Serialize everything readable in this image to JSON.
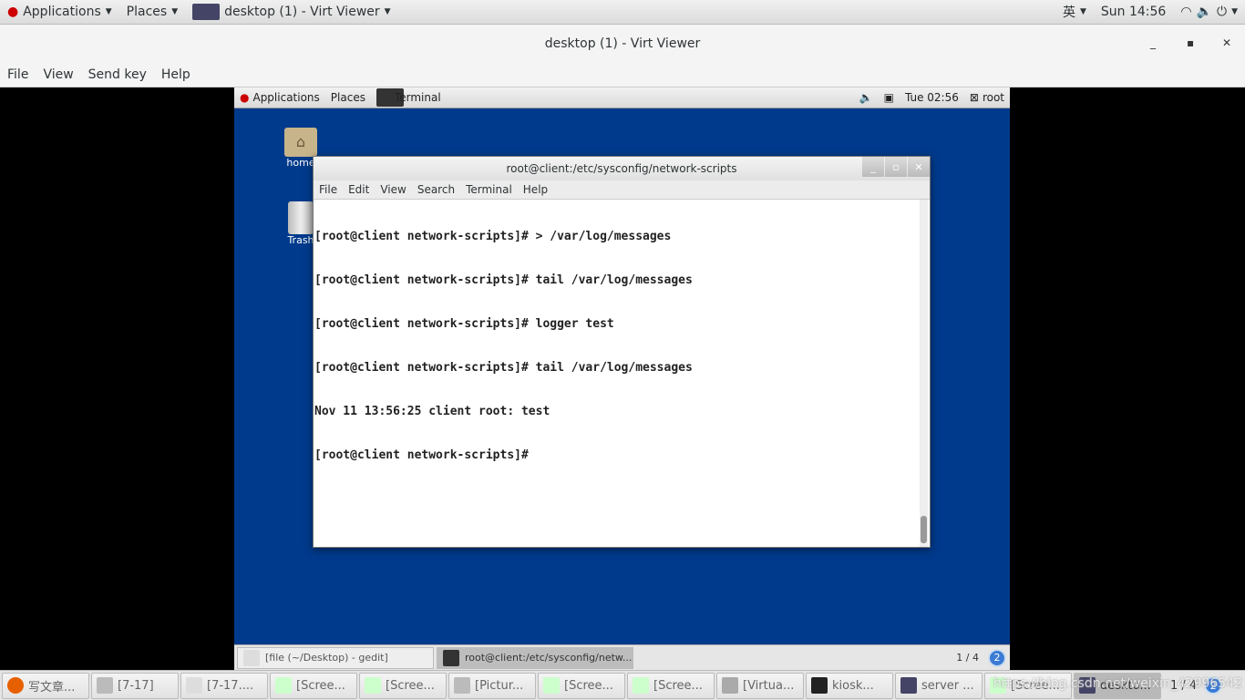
{
  "host_top": {
    "applications": "Applications",
    "places": "Places",
    "active_window": "desktop (1) - Virt Viewer",
    "input_method": "英",
    "clock": "Sun 14:56"
  },
  "viewer": {
    "title": "desktop (1) - Virt Viewer",
    "menu": [
      "File",
      "View",
      "Send key",
      "Help"
    ]
  },
  "guest_top": {
    "applications": "Applications",
    "places": "Places",
    "terminal": "Terminal",
    "clock": "Tue 02:56",
    "user": "root"
  },
  "desktop_icons": [
    {
      "label": "home",
      "icon": "home-folder-icon"
    },
    {
      "label": "Trash",
      "icon": "trash-icon"
    }
  ],
  "terminal": {
    "title": "root@client:/etc/sysconfig/network-scripts",
    "menu": [
      "File",
      "Edit",
      "View",
      "Search",
      "Terminal",
      "Help"
    ],
    "lines": [
      "[root@client network-scripts]# > /var/log/messages",
      "[root@client network-scripts]# tail /var/log/messages",
      "[root@client network-scripts]# logger test",
      "[root@client network-scripts]# tail /var/log/messages",
      "Nov 11 13:56:25 client root: test",
      "[root@client network-scripts]# "
    ]
  },
  "guest_bottom": {
    "tasks": [
      "[file (~/Desktop) - gedit]",
      "root@client:/etc/sysconfig/netw..."
    ],
    "workspace": "1 / 4",
    "badge": "2"
  },
  "host_taskbar": {
    "tasks": [
      {
        "label": "写文章...",
        "icon": "firefox-icon",
        "color": "#e66000"
      },
      {
        "label": "[7-17]",
        "icon": "file-cabinet-icon",
        "color": "#bbb"
      },
      {
        "label": "[7-17....",
        "icon": "text-editor-icon",
        "color": "#ddd"
      },
      {
        "label": "[Scree...",
        "icon": "image-viewer-icon",
        "color": "#cfc"
      },
      {
        "label": "[Scree...",
        "icon": "image-viewer-icon",
        "color": "#cfc"
      },
      {
        "label": "[Pictur...",
        "icon": "file-cabinet-icon",
        "color": "#bbb"
      },
      {
        "label": "[Scree...",
        "icon": "image-viewer-icon",
        "color": "#cfc"
      },
      {
        "label": "[Scree...",
        "icon": "image-viewer-icon",
        "color": "#cfc"
      },
      {
        "label": "[Virtua...",
        "icon": "virt-manager-icon",
        "color": "#aaa"
      },
      {
        "label": "kiosk...",
        "icon": "terminal-icon",
        "color": "#222"
      },
      {
        "label": "server ...",
        "icon": "monitor-icon",
        "color": "#446"
      },
      {
        "label": "[Scree...",
        "icon": "image-viewer-icon",
        "color": "#cfc"
      },
      {
        "label": "deskto...",
        "icon": "monitor-icon",
        "color": "#446",
        "active": true
      }
    ],
    "workspace": "1 / 4",
    "badge": "2"
  },
  "watermark": "https://blog.csdn.net/weixin_42996542",
  "colors": {
    "desktop": "#003a8c"
  }
}
